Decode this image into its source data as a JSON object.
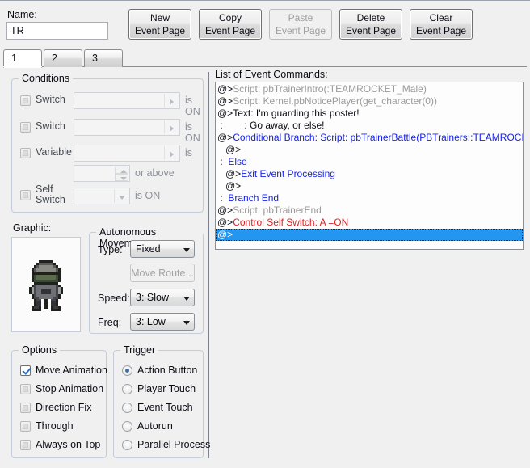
{
  "window": {
    "name_label": "Name:",
    "name_value": "TR"
  },
  "toolbar": {
    "buttons": [
      {
        "name": "new-event-page",
        "line1": "New",
        "line2": "Event Page",
        "disabled": false
      },
      {
        "name": "copy-event-page",
        "line1": "Copy",
        "line2": "Event Page",
        "disabled": false
      },
      {
        "name": "paste-event-page",
        "line1": "Paste",
        "line2": "Event Page",
        "disabled": true
      },
      {
        "name": "delete-event-page",
        "line1": "Delete",
        "line2": "Event Page",
        "disabled": false
      },
      {
        "name": "clear-event-page",
        "line1": "Clear",
        "line2": "Event Page",
        "disabled": false
      }
    ]
  },
  "tabs": {
    "items": [
      {
        "label": "1",
        "active": true
      },
      {
        "label": "2",
        "active": false
      },
      {
        "label": "3",
        "active": false
      }
    ],
    "selected": "1"
  },
  "conditions": {
    "legend": "Conditions",
    "rows": [
      {
        "label": "Switch",
        "checked": false,
        "value": "",
        "suffix": "is ON"
      },
      {
        "label": "Switch",
        "checked": false,
        "value": "",
        "suffix": "is ON"
      },
      {
        "label": "Variable",
        "checked": false,
        "value": "",
        "suffix": "is"
      },
      {
        "label": "",
        "checked": null,
        "value": "",
        "suffix": "or above"
      },
      {
        "label": "Self\nSwitch",
        "checked": false,
        "value": "",
        "suffix": "is ON"
      }
    ]
  },
  "graphic": {
    "label": "Graphic:",
    "sprite_name": "team-rocket-grunt-sprite"
  },
  "movement": {
    "legend": "Autonomous Movement",
    "type_label": "Type:",
    "type_value": "Fixed",
    "move_route_label": "Move Route...",
    "move_route_disabled": true,
    "speed_label": "Speed:",
    "speed_value": "3: Slow",
    "freq_label": "Freq:",
    "freq_value": "3: Low"
  },
  "options": {
    "legend": "Options",
    "items": [
      {
        "label": "Move Animation",
        "checked": true
      },
      {
        "label": "Stop Animation",
        "checked": false
      },
      {
        "label": "Direction Fix",
        "checked": false
      },
      {
        "label": "Through",
        "checked": false
      },
      {
        "label": "Always on Top",
        "checked": false
      }
    ]
  },
  "trigger": {
    "legend": "Trigger",
    "items": [
      {
        "label": "Action Button",
        "selected": true
      },
      {
        "label": "Player Touch",
        "selected": false
      },
      {
        "label": "Event Touch",
        "selected": false
      },
      {
        "label": "Autorun",
        "selected": false
      },
      {
        "label": "Parallel Process",
        "selected": false
      }
    ]
  },
  "command_list": {
    "label": "List of Event Commands:",
    "selected_index": 12,
    "rows": [
      {
        "segments": [
          {
            "text": "@>",
            "color": "black"
          },
          {
            "text": "Script: pbTrainerIntro(:TEAMROCKET_Male)",
            "color": "grey"
          }
        ]
      },
      {
        "segments": [
          {
            "text": "@>",
            "color": "black"
          },
          {
            "text": "Script: Kernel.pbNoticePlayer(get_character(0))",
            "color": "grey"
          }
        ]
      },
      {
        "segments": [
          {
            "text": "@>",
            "color": "black"
          },
          {
            "text": "Text: I'm guarding this poster!",
            "color": "black"
          }
        ]
      },
      {
        "segments": [
          {
            "text": " :        : Go away, or else!",
            "color": "black"
          }
        ]
      },
      {
        "segments": [
          {
            "text": "@>",
            "color": "black"
          },
          {
            "text": "Conditional Branch: Script: pbTrainerBattle(PBTrainers::TEAMROCKET_Male",
            "color": "blue"
          }
        ]
      },
      {
        "segments": [
          {
            "text": "   @>",
            "color": "black"
          }
        ]
      },
      {
        "segments": [
          {
            "text": " :  ",
            "color": "black"
          },
          {
            "text": "Else",
            "color": "blue"
          }
        ]
      },
      {
        "segments": [
          {
            "text": "   @>",
            "color": "black"
          },
          {
            "text": "Exit Event Processing",
            "color": "blue"
          }
        ]
      },
      {
        "segments": [
          {
            "text": "   @>",
            "color": "black"
          }
        ]
      },
      {
        "segments": [
          {
            "text": " :  ",
            "color": "black"
          },
          {
            "text": "Branch End",
            "color": "blue"
          }
        ]
      },
      {
        "segments": [
          {
            "text": "@>",
            "color": "black"
          },
          {
            "text": "Script: pbTrainerEnd",
            "color": "grey"
          }
        ]
      },
      {
        "segments": [
          {
            "text": "@>",
            "color": "black"
          },
          {
            "text": "Control Self Switch: A =ON",
            "color": "red"
          }
        ]
      },
      {
        "segments": [
          {
            "text": "@>",
            "color": "black"
          }
        ]
      }
    ]
  },
  "colors": {
    "window_bg": "#f0f0f0",
    "selection_blue": "#2496f0",
    "command_blue": "#1622e8",
    "command_red": "#e02020",
    "command_grey": "#9a9a9a"
  }
}
